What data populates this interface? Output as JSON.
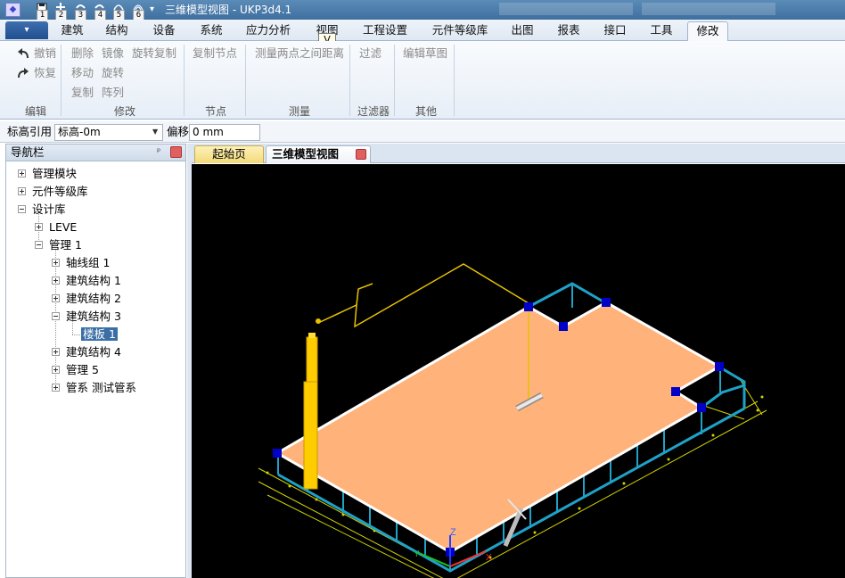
{
  "title": "三维模型视图 - UKP3d4.1",
  "quick_access": [
    {
      "icon": "save-icon",
      "num": "1"
    },
    {
      "icon": "new-icon",
      "num": "2"
    },
    {
      "icon": "undo-arrow-icon",
      "num": "3"
    },
    {
      "icon": "redo-arrow-icon",
      "num": "4"
    },
    {
      "icon": "view-icon",
      "num": "5"
    },
    {
      "icon": "view-rotate-icon",
      "num": "6"
    }
  ],
  "ribbon_tabs": [
    "建筑",
    "结构",
    "设备",
    "系统",
    "应力分析",
    "视图",
    "工程设置",
    "元件等级库",
    "出图",
    "报表",
    "接口",
    "工具",
    "修改"
  ],
  "active_tab": "修改",
  "tooltip": "V",
  "ribbon": {
    "edit": {
      "undo": "撤销",
      "redo": "恢复",
      "label": "编辑"
    },
    "modify": {
      "delete": "删除",
      "mirror": "镜像",
      "rotate_copy": "旋转复制",
      "move": "移动",
      "rotate": "旋转",
      "copy": "复制",
      "array": "阵列",
      "label": "修改"
    },
    "node": {
      "copy_node": "复制节点",
      "label": "节点"
    },
    "measure": {
      "distance": "测量两点之间距离",
      "label": "测量"
    },
    "filter": {
      "filter": "过滤",
      "label": "过滤器"
    },
    "other": {
      "edit_sketch": "编辑草图",
      "label": "其他"
    }
  },
  "toolbar": {
    "elevation_label": "标高引用",
    "elevation_value": "标高-0m",
    "offset_label": "偏移",
    "offset_value": "0 mm"
  },
  "nav": {
    "title": "导航栏",
    "items": {
      "mgmt_module": "管理模块",
      "component_lib": "元件等级库",
      "design_lib": "设计库",
      "leve": "LEVE",
      "mgmt1": "管理 1",
      "axis1": "轴线组 1",
      "struct1": "建筑结构 1",
      "struct2": "建筑结构 2",
      "struct3": "建筑结构 3",
      "slab1": "楼板 1",
      "struct4": "建筑结构 4",
      "mgmt5": "管理 5",
      "piping": "管系 测试管系"
    }
  },
  "doc_tabs": {
    "home": "起始页",
    "view3d": "三维模型视图"
  },
  "viewport": {
    "axis_z": "Z",
    "axis_y": "Y",
    "axis_x": "X"
  },
  "colors": {
    "slab": "#ffb27a",
    "frame": "#1fa2c8",
    "handle": "#0000c8",
    "pipe": "#e8c200",
    "background": "#000000"
  }
}
